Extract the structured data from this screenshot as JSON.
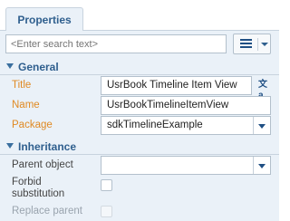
{
  "tabs": [
    {
      "label": "Properties"
    }
  ],
  "search": {
    "placeholder": "<Enter search text>"
  },
  "groups": {
    "general": {
      "title": "General"
    },
    "inheritance": {
      "title": "Inheritance"
    }
  },
  "general": {
    "title": {
      "label": "Title",
      "value": "UsrBook Timeline Item View",
      "icon": "language-icon"
    },
    "name": {
      "label": "Name",
      "value": "UsrBookTimelineItemView"
    },
    "package": {
      "label": "Package",
      "value": "sdkTimelineExample"
    }
  },
  "inheritance": {
    "parent_object": {
      "label": "Parent object",
      "value": ""
    },
    "forbid_substitution": {
      "label_line1": "Forbid",
      "label_line2": "substitution",
      "checked": false
    },
    "replace_parent": {
      "label": "Replace parent",
      "checked": false,
      "disabled": true
    }
  },
  "colors": {
    "accent": "#2f5f8e",
    "required_label": "#e08a23",
    "panel_bg": "#eaf1f8"
  }
}
